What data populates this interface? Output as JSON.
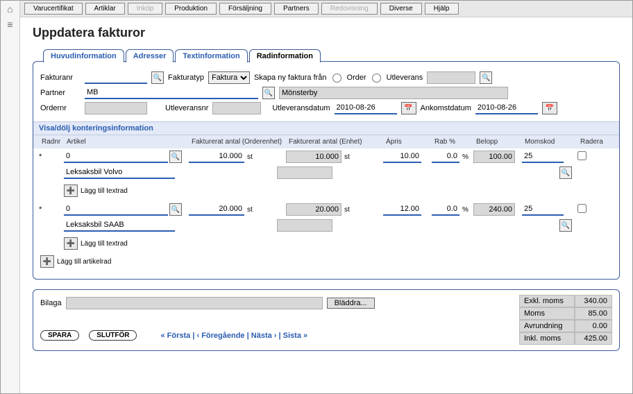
{
  "icons": {
    "home": "⌂",
    "menu": "≡"
  },
  "menu": {
    "varucertifikat": "Varucertifikat",
    "artiklar": "Artiklar",
    "inkop": "Inköp",
    "produktion": "Produktion",
    "forsaljning": "Försäljning",
    "partners": "Partners",
    "redovisning": "Redovisning",
    "diverse": "Diverse",
    "hjalp": "Hjälp"
  },
  "title": "Uppdatera fakturor",
  "tabs": {
    "huvud": "Huvudinformation",
    "adresser": "Adresser",
    "text": "Textinformation",
    "rad": "Radinformation"
  },
  "form": {
    "fakturanr_lbl": "Fakturanr",
    "fakturanr": "",
    "fakturatyp_lbl": "Fakturatyp",
    "fakturatyp_sel": "Faktura",
    "skapa_lbl": "Skapa ny faktura från",
    "order_lbl": "Order",
    "utlev_lbl": "Utleverans",
    "utlev_val": "",
    "partner_lbl": "Partner",
    "partner_code": "MB",
    "partner_name": "Mönsterby",
    "ordernr_lbl": "Ordernr",
    "ordernr": "",
    "utlevnr_lbl": "Utleveransnr",
    "utlevnr": "",
    "utlevdatum_lbl": "Utleveransdatum",
    "utlevdatum": "2010-08-26",
    "ankomst_lbl": "Ankomstdatum",
    "ankomstdatum": "2010-08-26"
  },
  "section": "Visa/dölj konteringsinformation",
  "headers": {
    "radnr": "Radnr",
    "artikel": "Artikel",
    "fakt_ord": "Fakturerat antal (Orderenhet)",
    "fakt_enh": "Fakturerat antal (Enhet)",
    "apris": "Ápris",
    "rab": "Rab %",
    "belopp": "Belopp",
    "momskod": "Momskod",
    "radera": "Radera"
  },
  "rows": [
    {
      "radnr": "*",
      "art": "0",
      "name": "Leksaksbil Volvo",
      "fakt_ord": "10.000",
      "unit1": "st",
      "fakt_enh": "10.000",
      "unit2": "st",
      "apris": "10.00",
      "rab": "0.0",
      "rabunit": "%",
      "belopp": "100.00",
      "moms": "25"
    },
    {
      "radnr": "*",
      "art": "0",
      "name": "Leksaksbil SAAB",
      "fakt_ord": "20.000",
      "unit1": "st",
      "fakt_enh": "20.000",
      "unit2": "st",
      "apris": "12.00",
      "rab": "0.0",
      "rabunit": "%",
      "belopp": "240.00",
      "moms": "25"
    }
  ],
  "textrad": "Lägg till textrad",
  "artikelrad": "Lägg till artikelrad",
  "bilaga_lbl": "Bilaga",
  "bladdra": "Bläddra...",
  "buttons": {
    "spara": "SPARA",
    "slutfor": "SLUTFÖR"
  },
  "nav": {
    "forsta": "« Första",
    "foregaende": "‹ Föregående",
    "nasta": "Nästa ›",
    "sista": "Sista »",
    "sep": " | "
  },
  "totals": {
    "exkl_lbl": "Exkl. moms",
    "exkl": "340.00",
    "moms_lbl": "Moms",
    "moms": "85.00",
    "avr_lbl": "Avrundning",
    "avr": "0.00",
    "inkl_lbl": "Inkl. moms",
    "inkl": "425.00"
  }
}
